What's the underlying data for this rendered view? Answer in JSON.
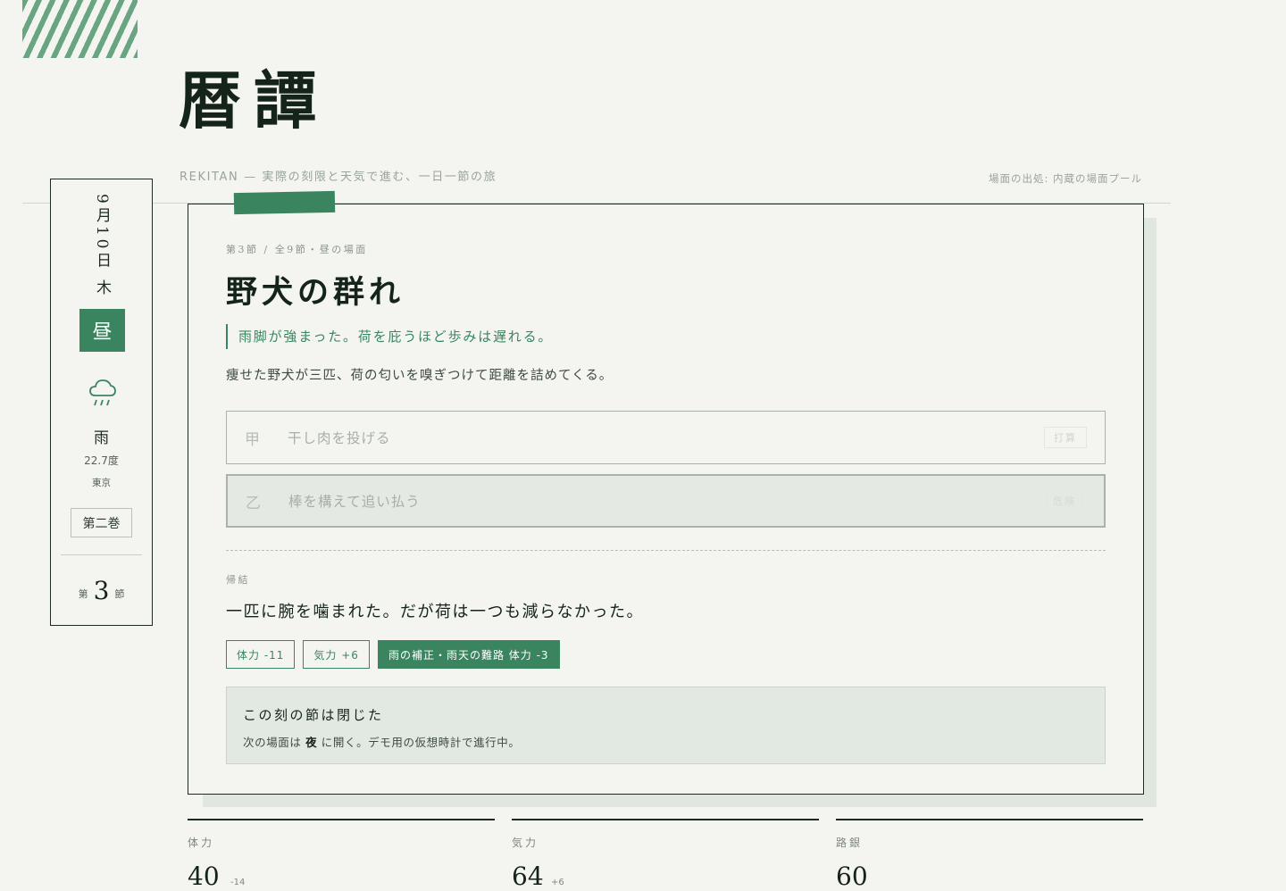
{
  "header": {
    "title": "暦譚",
    "subtitle": "REKITAN — 実際の刻限と天気で進む、一日一節の旅",
    "source": "場面の出処: 内蔵の場面プール"
  },
  "side": {
    "date": "9月10日 木",
    "period": "昼",
    "weather_icon": "rain-cloud-icon",
    "weather": "雨",
    "temperature": "22.7度",
    "city": "東京",
    "volume": "第二巻",
    "chapter_pre": "第",
    "chapter_num": "3",
    "chapter_post": "節"
  },
  "scene": {
    "kicker": "第3節 / 全9節・昼の場面",
    "title": "野犬の群れ",
    "quote": "雨脚が強まった。荷を庇うほど歩みは遅れる。",
    "description": "痩せた野犬が三匹、荷の匂いを嗅ぎつけて距離を詰めてくる。",
    "choices": [
      {
        "mark": "甲",
        "label": "干し肉を投げる",
        "tag": "打算"
      },
      {
        "mark": "乙",
        "label": "棒を構えて追い払う",
        "tag": "危険"
      }
    ],
    "result_label": "帰結",
    "result_text": "一匹に腕を噛まれた。だが荷は一つも減らなかった。",
    "chips": [
      {
        "label": "体力 -11"
      },
      {
        "label": "気力 +6"
      },
      {
        "label": "雨の補正・雨天の難路 体力 -3"
      }
    ],
    "closed_title": "この刻の節は閉じた",
    "closed_pre": "次の場面は",
    "closed_next": "夜",
    "closed_post": "に開く。デモ用の仮想時計で進行中。"
  },
  "stats": [
    {
      "name": "体力",
      "value": "40",
      "delta": "-14"
    },
    {
      "name": "気力",
      "value": "64",
      "delta": "+6"
    },
    {
      "name": "路銀",
      "value": "60",
      "delta": ""
    }
  ],
  "colors": {
    "accent": "#3a8560",
    "ink": "#15241b",
    "paper": "#f4f5f0"
  }
}
